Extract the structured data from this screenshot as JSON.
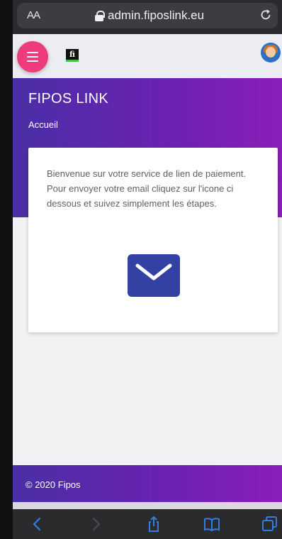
{
  "browser": {
    "text_size_label": "AA",
    "url": "admin.fiposlink.eu",
    "icons": {
      "lock": "lock-icon",
      "reload": "reload-icon",
      "back": "back-icon",
      "forward": "forward-icon",
      "share": "share-icon",
      "bookmarks": "bookmarks-icon",
      "tabs": "tabs-icon"
    }
  },
  "navbar": {
    "menu_icon": "hamburger-menu-icon",
    "logo_text": "fi",
    "avatar": "user-avatar"
  },
  "header": {
    "title": "FIPOS LINK",
    "breadcrumb": "Accueil"
  },
  "card": {
    "text": "Bienvenue sur votre service de lien de paiement. Pour envoyer votre email cliquez sur l'icone ci dessous et suivez simplement les étapes.",
    "action_icon": "envelope-icon"
  },
  "footer": {
    "copyright": "© 2020",
    "brand": "Fipos"
  },
  "colors": {
    "fab": "#ee3b7b",
    "gradient_start": "#4a2fa6",
    "gradient_end": "#8b1eb8",
    "envelope_button": "#3340a4",
    "card_text": "#5f5f68"
  }
}
